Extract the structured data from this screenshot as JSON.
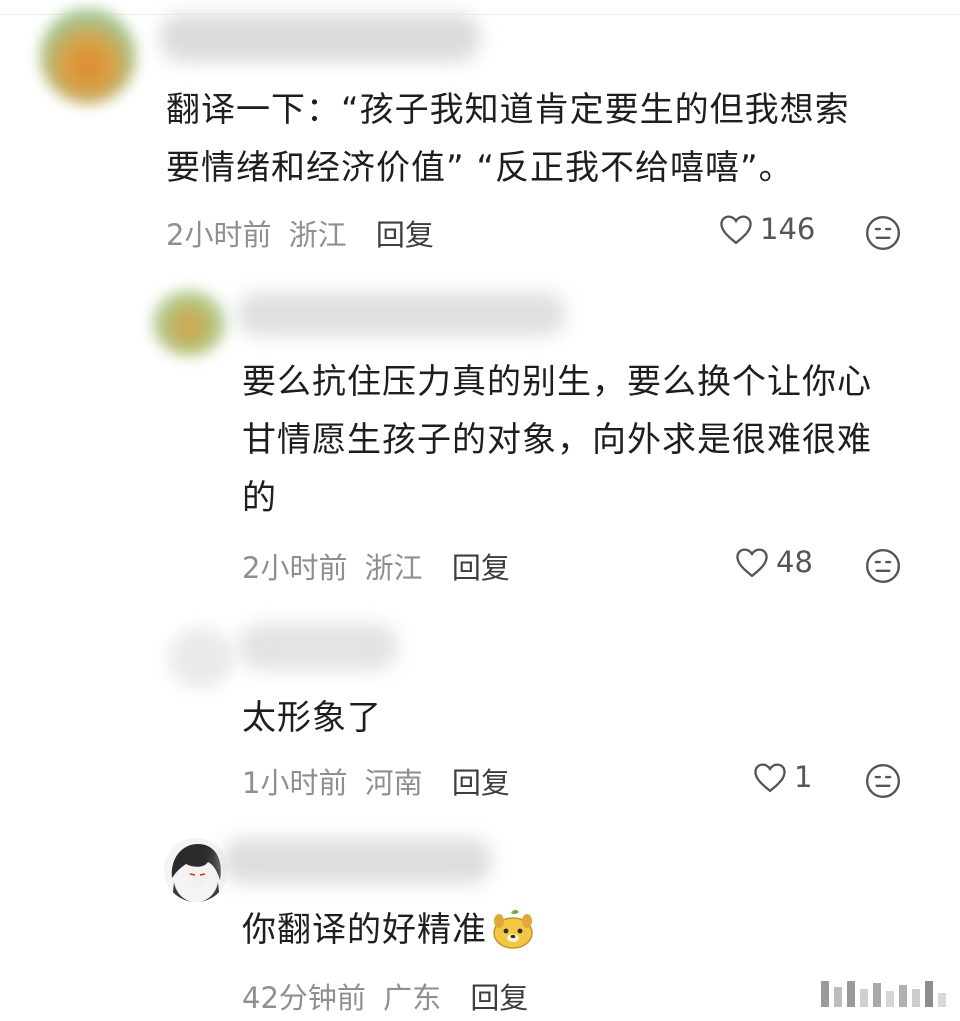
{
  "comments": [
    {
      "text_lines": [
        "翻译一下：“孩子我知道肯定要生的但我想索",
        "要情绪和经济价值” “反正我不给嘻嘻”。"
      ],
      "time": "2小时前",
      "location": "浙江",
      "reply_label": "回复",
      "likes": "146"
    },
    {
      "text_lines": [
        "要么抗住压力真的别生，要么换个让你心",
        "甘情愿生孩子的对象，向外求是很难很难",
        "的"
      ],
      "time": "2小时前",
      "location": "浙江",
      "reply_label": "回复",
      "likes": "48"
    },
    {
      "text_lines": [
        "太形象了"
      ],
      "time": "1小时前",
      "location": "河南",
      "reply_label": "回复",
      "likes": "1"
    },
    {
      "text_lines": [
        "你翻译的好精准"
      ],
      "time": "42分钟前",
      "location": "广东",
      "reply_label": "回复"
    }
  ],
  "colors": {
    "text": "#1e1e1e",
    "meta": "#8f8f8f",
    "icon": "#555555"
  }
}
